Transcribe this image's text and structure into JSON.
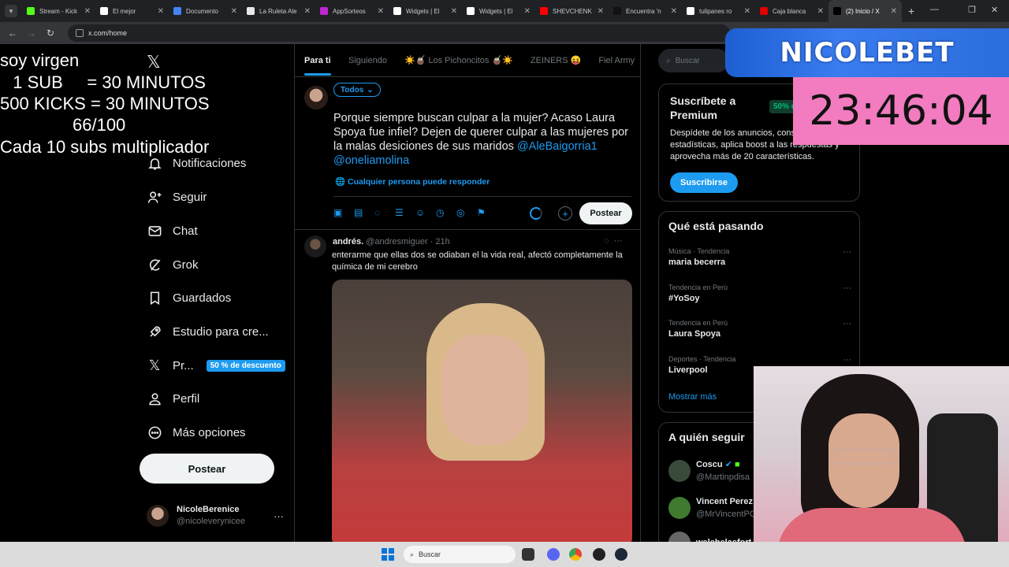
{
  "browser": {
    "tabs": [
      {
        "title": "Stream - Kick",
        "color": "#53fc18"
      },
      {
        "title": "El mejor",
        "color": "#ffffff"
      },
      {
        "title": "Documento",
        "color": "#4285f4"
      },
      {
        "title": "La Ruleta Ale",
        "color": "#e8e8e8"
      },
      {
        "title": "AppSorteos",
        "color": "#c026d3"
      },
      {
        "title": "Widgets | El",
        "color": "#ffffff"
      },
      {
        "title": "Widgets | El",
        "color": "#ffffff"
      },
      {
        "title": "SHEVCHENK",
        "color": "#ff0000"
      },
      {
        "title": "Encuentra 'n",
        "color": "#111111"
      },
      {
        "title": "tulipanes ro",
        "color": "#ffffff"
      },
      {
        "title": "Caja blanca",
        "color": "#e00000"
      },
      {
        "title": "(2) Inicio / X",
        "color": "#000000"
      }
    ],
    "url": "x.com/home"
  },
  "overlay": {
    "line1": "soy virgen",
    "line2": "  1 SUB     = 30 MINUTOS",
    "line3": "500 KICKS = 30 MINUTOS",
    "line4": "66/100",
    "line5": "Cada 10 subs multiplicador"
  },
  "nav": {
    "items": [
      {
        "label": "Notificaciones",
        "icon": "bell-icon"
      },
      {
        "label": "Seguir",
        "icon": "follow-icon"
      },
      {
        "label": "Chat",
        "icon": "mail-icon"
      },
      {
        "label": "Grok",
        "icon": "grok-icon"
      },
      {
        "label": "Guardados",
        "icon": "bookmark-icon"
      },
      {
        "label": "Estudio para cre...",
        "icon": "rocket-icon"
      },
      {
        "label": "Pr...",
        "icon": "x-logo-icon"
      },
      {
        "label": "Perfil",
        "icon": "person-icon"
      },
      {
        "label": "Más opciones",
        "icon": "more-icon"
      }
    ],
    "premium_badge": "50 % de descuento",
    "post_button": "Postear",
    "profile_name": "NicoleBerenice",
    "profile_handle": "@nicoleverynicee"
  },
  "feed": {
    "tabs": [
      "Para ti",
      "Siguiendo",
      "☀️🧉 Los Pichoncitos 🧉☀️",
      "ZEINERS 😝",
      "Fiel Army"
    ],
    "audience": "Todos",
    "compose_text": "Porque siempre buscan culpar a la mujer? Acaso Laura Spoya fue infiel? Dejen de querer culpar a las mujeres por la malas desiciones de sus maridos ",
    "mention1": "@AleBaigorria1",
    "mention2": "@oneliamolina",
    "reply_setting": "🌐 Cualquier persona puede responder",
    "post_button": "Postear",
    "tweet": {
      "name": "andrés.",
      "handle": "@andresmiguer · 21h",
      "text": "enterarme que ellas dos se odiaban el la vida real, afectó completamente la química de mi cerebro"
    }
  },
  "right": {
    "search_placeholder": "Buscar",
    "premium": {
      "title": "Suscríbete a Premium",
      "badge": "50% de",
      "text": "Despídete de los anuncios, consulta estadísticas, aplica boost a las respuestas y aprovecha más de 20 características.",
      "button": "Suscribirse"
    },
    "trends_title": "Qué está pasando",
    "trends": [
      {
        "meta": "Música · Tendencia",
        "name": "maria becerra"
      },
      {
        "meta": "Tendencia en Perú",
        "name": "#YoSoy"
      },
      {
        "meta": "Tendencia en Perú",
        "name": "Laura Spoya"
      },
      {
        "meta": "Deportes · Tendencia",
        "name": "Liverpool"
      }
    ],
    "show_more": "Mostrar más",
    "follow_title": "A quién seguir",
    "follows": [
      {
        "name": "Coscu",
        "handle": "@Martinpdisa"
      },
      {
        "name": "Vincent Perez",
        "handle": "@MrVincentPC"
      },
      {
        "name": "welchelasfort",
        "handle": ""
      }
    ]
  },
  "stream": {
    "banner": "NICOLEBET",
    "timer": "23:46:04"
  },
  "taskbar": {
    "search": "Buscar"
  },
  "colors": {
    "accent": "#1d9bf0",
    "timer_bg": "#f27cbf",
    "banner_bg": "#2b6ddc"
  }
}
